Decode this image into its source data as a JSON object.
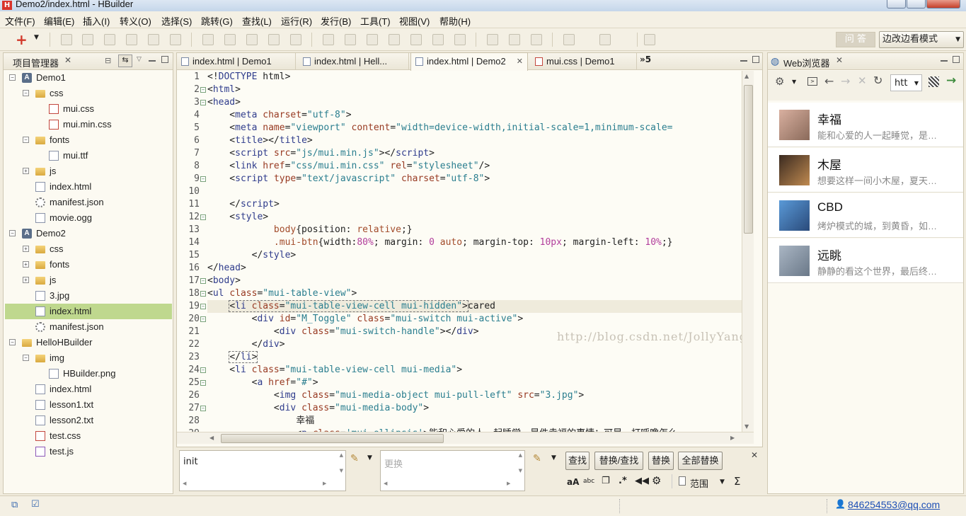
{
  "window": {
    "title": "Demo2/index.html  -  HBuilder"
  },
  "menu": [
    "文件(F)",
    "编辑(E)",
    "插入(I)",
    "转义(O)",
    "选择(S)",
    "跳转(G)",
    "查找(L)",
    "运行(R)",
    "发行(B)",
    "工具(T)",
    "视图(V)",
    "帮助(H)"
  ],
  "toolbar": {
    "ask_label": "问 答",
    "mode_label": "边改边看模式"
  },
  "project_panel": {
    "title": "项目管理器",
    "items": [
      {
        "label": "Demo1",
        "icon": "project-icon",
        "indent": 0,
        "exp": "minus"
      },
      {
        "label": "css",
        "icon": "folder-icon",
        "indent": 1,
        "exp": "minus"
      },
      {
        "label": "mui.css",
        "icon": "css-file-icon",
        "indent": 2,
        "exp": ""
      },
      {
        "label": "mui.min.css",
        "icon": "css-file-icon",
        "indent": 2,
        "exp": ""
      },
      {
        "label": "fonts",
        "icon": "folder-icon",
        "indent": 1,
        "exp": "minus"
      },
      {
        "label": "mui.ttf",
        "icon": "file-icon",
        "indent": 2,
        "exp": ""
      },
      {
        "label": "js",
        "icon": "folder-icon",
        "indent": 1,
        "exp": "plus"
      },
      {
        "label": "index.html",
        "icon": "file-icon",
        "indent": 1,
        "exp": ""
      },
      {
        "label": "manifest.json",
        "icon": "gear-file-icon",
        "indent": 1,
        "exp": ""
      },
      {
        "label": "movie.ogg",
        "icon": "file-icon",
        "indent": 1,
        "exp": ""
      },
      {
        "label": "Demo2",
        "icon": "project-icon",
        "indent": 0,
        "exp": "minus"
      },
      {
        "label": "css",
        "icon": "folder-icon",
        "indent": 1,
        "exp": "plus"
      },
      {
        "label": "fonts",
        "icon": "folder-icon",
        "indent": 1,
        "exp": "plus"
      },
      {
        "label": "js",
        "icon": "folder-icon",
        "indent": 1,
        "exp": "plus"
      },
      {
        "label": "3.jpg",
        "icon": "file-icon",
        "indent": 1,
        "exp": ""
      },
      {
        "label": "index.html",
        "icon": "file-icon",
        "indent": 1,
        "exp": "",
        "selected": true
      },
      {
        "label": "manifest.json",
        "icon": "gear-file-icon",
        "indent": 1,
        "exp": ""
      },
      {
        "label": "HelloHBuilder",
        "icon": "folder-icon",
        "indent": 0,
        "exp": "minus"
      },
      {
        "label": "img",
        "icon": "folder-icon",
        "indent": 1,
        "exp": "minus"
      },
      {
        "label": "HBuilder.png",
        "icon": "file-icon",
        "indent": 2,
        "exp": ""
      },
      {
        "label": "index.html",
        "icon": "file-icon",
        "indent": 1,
        "exp": ""
      },
      {
        "label": "lesson1.txt",
        "icon": "file-icon",
        "indent": 1,
        "exp": ""
      },
      {
        "label": "lesson2.txt",
        "icon": "file-icon",
        "indent": 1,
        "exp": ""
      },
      {
        "label": "test.css",
        "icon": "css-file-icon",
        "indent": 1,
        "exp": ""
      },
      {
        "label": "test.js",
        "icon": "js-file-icon",
        "indent": 1,
        "exp": ""
      }
    ]
  },
  "editor": {
    "tabs": [
      {
        "label": "index.html | Demo1",
        "active": false,
        "css": false
      },
      {
        "label": "index.html | Hell...",
        "active": false,
        "css": false
      },
      {
        "label": "index.html | Demo2",
        "active": true,
        "css": false
      },
      {
        "label": "mui.css | Demo1",
        "active": false,
        "css": true
      }
    ],
    "overflow_label": "»5",
    "watermark": "http://blog.csdn.net/JollyYang_",
    "lines": [
      {
        "n": "1",
        "fold": "",
        "h": "&lt;!<span class='kw'>DOCTYPE</span> html&gt;"
      },
      {
        "n": "2",
        "fold": "-",
        "h": "&lt;<span class='tag'>html</span>&gt;"
      },
      {
        "n": "3",
        "fold": "-",
        "h": "&lt;<span class='tag'>head</span>&gt;"
      },
      {
        "n": "4",
        "fold": "",
        "h": "    &lt;<span class='tag'>meta</span> <span class='attr'>charset</span>=<span class='val'>\"utf-8\"</span>&gt;"
      },
      {
        "n": "5",
        "fold": "",
        "h": "    &lt;<span class='tag'>meta</span> <span class='attr'>name</span>=<span class='val'>\"viewport\"</span> <span class='attr'>content</span>=<span class='val'>\"width=device-width,initial-scale=1,minimum-scale=</span>"
      },
      {
        "n": "6",
        "fold": "",
        "h": "    &lt;<span class='tag'>title</span>&gt;&lt;/<span class='tag'>title</span>&gt;"
      },
      {
        "n": "7",
        "fold": "",
        "h": "    &lt;<span class='tag'>script</span> <span class='attr'>src</span>=<span class='val'>\"js/mui.min.js\"</span>&gt;&lt;/<span class='tag'>script</span>&gt;"
      },
      {
        "n": "8",
        "fold": "",
        "h": "    &lt;<span class='tag'>link</span> <span class='attr'>href</span>=<span class='val'>\"css/mui.min.css\"</span> <span class='attr'>rel</span>=<span class='val'>\"stylesheet\"</span>/&gt;"
      },
      {
        "n": "9",
        "fold": "-",
        "h": "    &lt;<span class='tag'>script</span> <span class='attr'>type</span>=<span class='val'>\"text/javascript\"</span> <span class='attr'>charset</span>=<span class='val'>\"utf-8\"</span>&gt;"
      },
      {
        "n": "10",
        "fold": "",
        "h": ""
      },
      {
        "n": "11",
        "fold": "",
        "h": "    &lt;/<span class='tag'>script</span>&gt;"
      },
      {
        "n": "12",
        "fold": "-",
        "h": "    &lt;<span class='tag'>style</span>&gt;"
      },
      {
        "n": "13",
        "fold": "",
        "h": "            <span class='cssprop'>body</span>{position: <span class='cssprop'>relative</span>;}"
      },
      {
        "n": "14",
        "fold": "",
        "h": "            <span class='cssprop'>.mui-btn</span>{width:<span class='num'>80%</span>; margin: <span class='num'>0</span> <span class='cssprop'>auto</span>; margin-top: <span class='num'>10px</span>; margin-left: <span class='num'>10%</span>;}"
      },
      {
        "n": "15",
        "fold": "",
        "h": "        &lt;/<span class='tag'>style</span>&gt;"
      },
      {
        "n": "16",
        "fold": "",
        "h": "&lt;/<span class='tag'>head</span>&gt;"
      },
      {
        "n": "17",
        "fold": "-",
        "h": "&lt;<span class='tag'>body</span>&gt;"
      },
      {
        "n": "18",
        "fold": "-",
        "h": "&lt;<span class='tag'>ul</span> <span class='attr'>class</span>=<span class='val'>\"mui-table-view\"</span>&gt;"
      },
      {
        "n": "19",
        "fold": "-",
        "hl": true,
        "h": "    <span style='outline:1px dashed #777'>&lt;<span class='tag'>li</span> <span class='attr'>class</span>=<span class='val'>\"mui-table-view-cell mui-hidden\"</span>&gt;</span>cared"
      },
      {
        "n": "20",
        "fold": "-",
        "h": "        &lt;<span class='tag'>div</span> <span class='attr'>id</span>=<span class='val'>\"M_Toggle\"</span> <span class='attr'>class</span>=<span class='val'>\"mui-switch mui-active\"</span>&gt;"
      },
      {
        "n": "21",
        "fold": "",
        "h": "            &lt;<span class='tag'>div</span> <span class='attr'>class</span>=<span class='val'>\"mui-switch-handle\"</span>&gt;&lt;/<span class='tag'>div</span>&gt;"
      },
      {
        "n": "22",
        "fold": "",
        "h": "        &lt;/<span class='tag'>div</span>&gt;"
      },
      {
        "n": "23",
        "fold": "",
        "h": "    <span style='outline:1px dashed #777'>&lt;/<span class='tag'>li</span>&gt;</span>"
      },
      {
        "n": "24",
        "fold": "-",
        "h": "    &lt;<span class='tag'>li</span> <span class='attr'>class</span>=<span class='val'>\"mui-table-view-cell mui-media\"</span>&gt;"
      },
      {
        "n": "25",
        "fold": "-",
        "h": "        &lt;<span class='tag'>a</span> <span class='attr'>href</span>=<span class='val'>\"#\"</span>&gt;"
      },
      {
        "n": "26",
        "fold": "",
        "h": "            &lt;<span class='tag'>img</span> <span class='attr'>class</span>=<span class='val'>\"mui-media-object mui-pull-left\"</span> <span class='attr'>src</span>=<span class='val'>\"3.jpg\"</span>&gt;"
      },
      {
        "n": "27",
        "fold": "-",
        "h": "            &lt;<span class='tag'>div</span> <span class='attr'>class</span>=<span class='val'>\"mui-media-body\"</span>&gt;"
      },
      {
        "n": "28",
        "fold": "",
        "h": "                幸福"
      },
      {
        "n": "29",
        "fold": "",
        "h": "                &lt;<span class='tag'>p</span> <span class='attr'>class</span>=<span class='val'>'mui-ellipsis'</span>&gt;能和心爱的人一起睡觉，是件幸福的事情；可是，打呼噜怎么"
      }
    ]
  },
  "find": {
    "find_value": "init",
    "replace_placeholder": "更换",
    "buttons": [
      "查找",
      "替换/查找",
      "替换",
      "全部替换"
    ],
    "options": {
      "case": "aA",
      "whole": "abc",
      "regex": ".*",
      "scope_label": "范围",
      "sigma": "Σ"
    }
  },
  "browser": {
    "title": "Web浏览器",
    "url_value": "htt",
    "items": [
      {
        "title": "幸福",
        "sub": "能和心爱的人一起睡觉，是…",
        "colors": [
          "#d9b0a0",
          "#8a6a5a"
        ]
      },
      {
        "title": "木屋",
        "sub": "想要这样一间小木屋，夏天…",
        "colors": [
          "#3a2a20",
          "#c08a50"
        ]
      },
      {
        "title": "CBD",
        "sub": "烤炉模式的城，到黄昏，如…",
        "colors": [
          "#5a9ad8",
          "#2a4a7a"
        ]
      },
      {
        "title": "远眺",
        "sub": "静静的看这个世界，最后终…",
        "colors": [
          "#aab6c4",
          "#6a7888"
        ]
      }
    ]
  },
  "status": {
    "email": "846254553@qq.com"
  }
}
